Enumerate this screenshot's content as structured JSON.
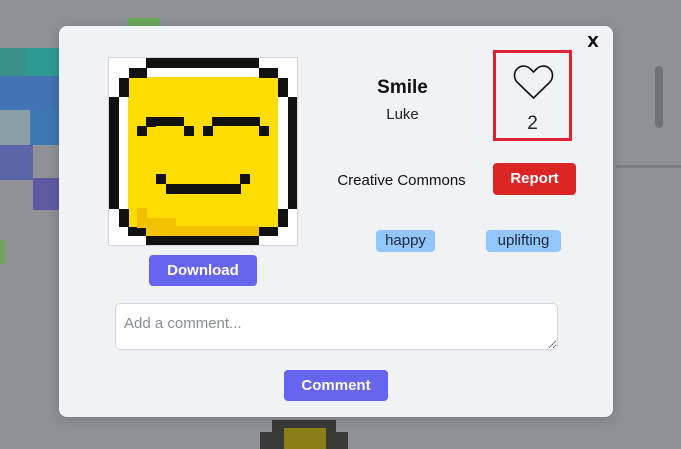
{
  "modal": {
    "close_label": "X",
    "artwork": {
      "title": "Smile",
      "author": "Luke",
      "license": "Creative Commons",
      "image_alt": "pixel art smiley face"
    },
    "likes": {
      "count": "2"
    },
    "buttons": {
      "download": "Download",
      "report": "Report",
      "comment": "Comment"
    },
    "tags": [
      "happy",
      "uplifting"
    ],
    "comment": {
      "placeholder": "Add a comment...",
      "value": ""
    }
  },
  "colors": {
    "overlay": "#8f9197",
    "modal_bg": "#f1f2f5",
    "primary_button": "#6764ef",
    "report_button": "#dc2626",
    "like_highlight": "#e0212f",
    "tag_bg": "#93c5fd",
    "smiley_yellow": "#ffdd00"
  }
}
